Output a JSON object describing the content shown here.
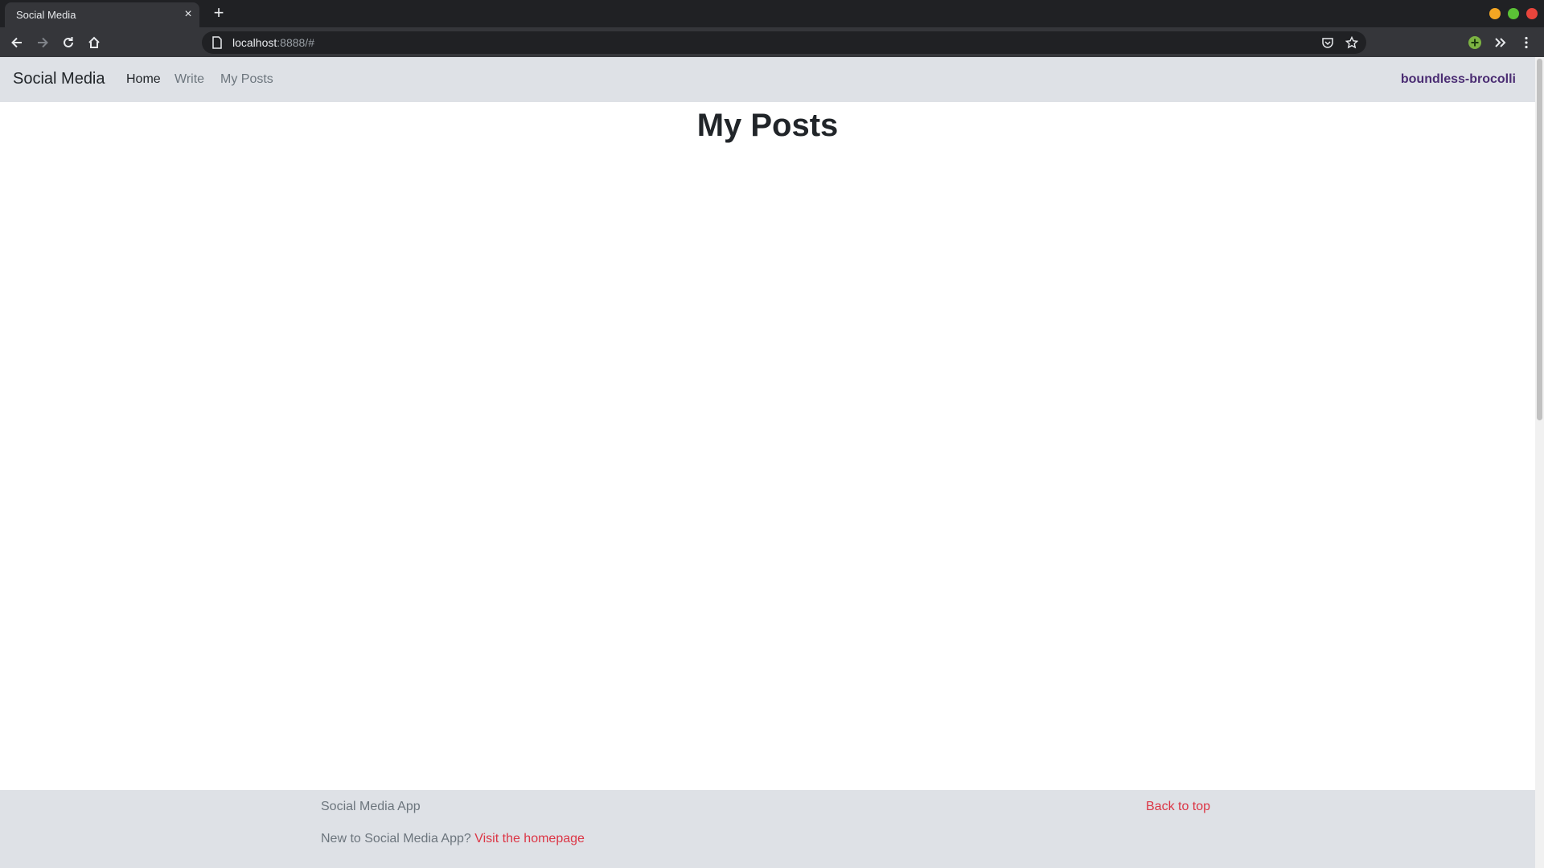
{
  "browser": {
    "tab_title": "Social Media",
    "tab_close": "×",
    "new_tab": "+",
    "url_host": "localhost",
    "url_rest": ":8888/#",
    "window_controls": {
      "minimize_color": "#f5a623",
      "maximize_color": "#5bc236",
      "close_color": "#e8453c"
    }
  },
  "navbar": {
    "brand": "Social Media",
    "links": [
      {
        "label": "Home",
        "active": true
      },
      {
        "label": "Write",
        "active": false
      },
      {
        "label": "My Posts",
        "active": false
      }
    ],
    "username": "boundless-brocolli"
  },
  "main": {
    "title": "My Posts"
  },
  "footer": {
    "brand": "Social Media App",
    "back_to_top": "Back to top",
    "prompt": "New to Social Media App?",
    "homepage_link": "Visit the homepage"
  },
  "colors": {
    "navbar_bg": "#dee1e6",
    "link_accent": "#dc3545",
    "username": "#4b2d73"
  }
}
